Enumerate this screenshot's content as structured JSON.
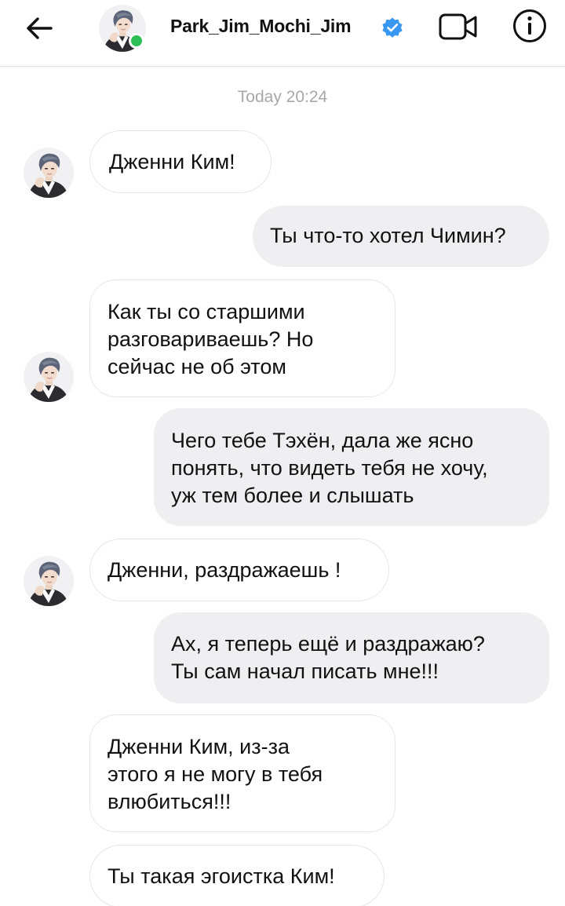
{
  "header": {
    "back_icon": "arrow-left-icon",
    "username": "Park_Jim_Mochi_Jim",
    "verified_icon": "verified-badge-icon",
    "video_icon": "video-camera-icon",
    "info_icon": "info-icon",
    "online_status_color": "#2dbf55"
  },
  "chat": {
    "timestamp": "Today 20:24",
    "messages": [
      {
        "direction": "incoming",
        "lines": [
          "Дженни Ким!"
        ]
      },
      {
        "direction": "outgoing",
        "lines": [
          "Ты что-то хотел Чимин?"
        ]
      },
      {
        "direction": "incoming",
        "lines": [
          "Как ты со старшими",
          "разговариваешь? Но",
          "сейчас не об этом"
        ]
      },
      {
        "direction": "outgoing",
        "lines": [
          "Чего тебе Тэхён, дала же ясно",
          "понять, что видеть тебя не хочу,",
          "уж тем более и слышать"
        ]
      },
      {
        "direction": "incoming",
        "lines": [
          "Дженни, раздражаешь !"
        ]
      },
      {
        "direction": "outgoing",
        "lines": [
          "Ах, я теперь ещё и раздражаю?",
          "Ты сам начал писать мне!!!"
        ]
      },
      {
        "direction": "incoming",
        "lines": [
          "Дженни Ким, из-за",
          "этого я не могу в тебя",
          "влюбиться!!!"
        ]
      },
      {
        "direction": "incoming",
        "lines": [
          "Ты такая эгоистка Ким!"
        ]
      }
    ]
  },
  "colors": {
    "outgoing_bubble": "#efeff1",
    "incoming_bubble_border": "#e6e6e6",
    "verified_blue": "#3897f0",
    "timestamp_text": "#a8a8a8"
  }
}
